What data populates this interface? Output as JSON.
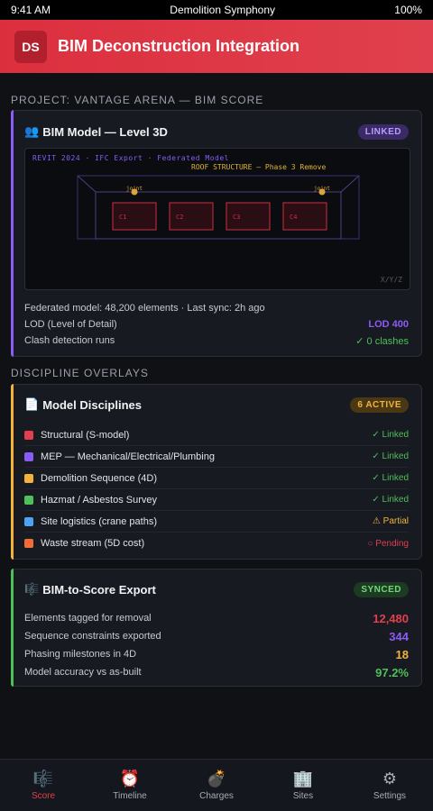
{
  "status": {
    "time": "9:41 AM",
    "title": "Demolition Symphony",
    "battery": "100%"
  },
  "header": {
    "logo": "DS",
    "title": "BIM Deconstruction Integration"
  },
  "project_label": "PROJECT: VANTAGE ARENA — BIM SCORE",
  "bim_card": {
    "icon": "👥",
    "title": "BIM Model — Level 3D",
    "badge": "LINKED",
    "viewer": {
      "header": "REVIT 2024 · IFC Export · Federated Model",
      "roof": "ROOF STRUCTURE — Phase 3 Remove",
      "joints": [
        "joint",
        "joint"
      ],
      "columns": [
        "C1",
        "C2",
        "C3",
        "C4"
      ],
      "axes": "X/Y/Z"
    },
    "meta": "Federated model: 48,200 elements · Last sync: 2h ago",
    "lod_label": "LOD (Level of Detail)",
    "lod_value": "LOD 400",
    "clash_label": "Clash detection runs",
    "clash_value": "✓ 0 clashes"
  },
  "overlay_label": "DISCIPLINE OVERLAYS",
  "disciplines_card": {
    "icon": "📄",
    "title": "Model Disciplines",
    "badge": "6 ACTIVE",
    "items": [
      {
        "label": "Structural (S-model)",
        "status": "✓ Linked",
        "color": "#e0404d",
        "status_color": "#4fbf5a"
      },
      {
        "label": "MEP — Mechanical/Electrical/Plumbing",
        "status": "✓ Linked",
        "color": "#8a5cf6",
        "status_color": "#4fbf5a"
      },
      {
        "label": "Demolition Sequence (4D)",
        "status": "✓ Linked",
        "color": "#f2b33d",
        "status_color": "#4fbf5a"
      },
      {
        "label": "Hazmat / Asbestos Survey",
        "status": "✓ Linked",
        "color": "#4fbf5a",
        "status_color": "#4fbf5a"
      },
      {
        "label": "Site logistics (crane paths)",
        "status": "⚠ Partial",
        "color": "#4da3f0",
        "status_color": "#f2b33d"
      },
      {
        "label": "Waste stream (5D cost)",
        "status": "○ Pending",
        "color": "#f06d3a",
        "status_color": "#e0404d"
      }
    ]
  },
  "export_card": {
    "icon": "🎼",
    "title": "BIM-to-Score Export",
    "badge": "SYNCED",
    "rows": [
      {
        "label": "Elements tagged for removal",
        "value": "12,480",
        "color": "#e0404d"
      },
      {
        "label": "Sequence constraints exported",
        "value": "344",
        "color": "#8a5cf6"
      },
      {
        "label": "Phasing milestones in 4D",
        "value": "18",
        "color": "#f2b33d"
      },
      {
        "label": "Model accuracy vs as-built",
        "value": "97.2%",
        "color": "#4fbf5a"
      }
    ]
  },
  "nav": [
    {
      "icon": "🎼",
      "label": "Score",
      "active": true
    },
    {
      "icon": "⏰",
      "label": "Timeline",
      "active": false
    },
    {
      "icon": "💣",
      "label": "Charges",
      "active": false
    },
    {
      "icon": "🏢",
      "label": "Sites",
      "active": false
    },
    {
      "icon": "⚙",
      "label": "Settings",
      "active": false
    }
  ],
  "colors": {
    "accent": "#e0404d",
    "purple": "#8a5cf6",
    "amber": "#f2b33d",
    "green": "#4fbf5a"
  }
}
